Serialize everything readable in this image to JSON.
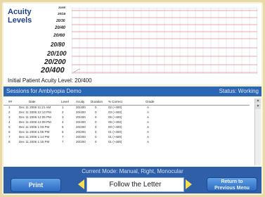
{
  "chart": {
    "title_line1": "Acuity",
    "title_line2": "Levels",
    "y_levels": [
      "20/05",
      "20/15",
      "20/30",
      "20/40",
      "20/60",
      "20/80",
      "20/100",
      "20/200",
      "20/400"
    ],
    "initial_label": "Initial Patient Acuity Level: 20/400"
  },
  "sessions": {
    "title": "Sessions for Amblyopia Demo",
    "status": "Status: Working",
    "columns": [
      "##",
      "Date",
      "Level",
      "Acuity",
      "Duration",
      "% Correct",
      "Grade"
    ],
    "rows": [
      [
        "1",
        "Dec 11 2006 11:21 AM",
        "1",
        "20/400",
        "0",
        "02 (+400)",
        "A"
      ],
      [
        "2",
        "Dec 11 2006 12:13 PM",
        "2",
        "20/400",
        "0",
        "03 (+400)",
        "A"
      ],
      [
        "3",
        "Dec 11 2006 12:05 PM",
        "3",
        "20/400",
        "0",
        "05 (+400)",
        "A"
      ],
      [
        "4",
        "Dec 11 2006 12:09 PM",
        "4",
        "20/400",
        "0",
        "05 (+400)",
        "A"
      ],
      [
        "5",
        "Dec 11 2006 1:03 PM",
        "5",
        "20/200",
        "0",
        "00 (+400)",
        "A"
      ],
      [
        "6",
        "Dec 11 2006 1:05 PM",
        "5",
        "20/200",
        "0",
        "01 (+400)",
        "A"
      ],
      [
        "7",
        "Dec 11 2006 1:14 PM",
        "7",
        "20/200",
        "0",
        "01 (+400)",
        "A"
      ],
      [
        "8",
        "Dec 11 2006 1:15 PM",
        "7",
        "20/200",
        "0",
        "01 (+400)",
        "A"
      ]
    ]
  },
  "footer": {
    "mode": "Current Mode: Manual, Right, Monocular",
    "print_label": "Print",
    "selection": "Follow the Letter",
    "return_line1": "Return to",
    "return_line2": "Previous Menu"
  },
  "colors": {
    "grid_red": "#e58a8a",
    "grid_blue": "#9fb7d8",
    "bar_blue": "#2b67b5",
    "arrow_yellow": "#f6e04a"
  }
}
